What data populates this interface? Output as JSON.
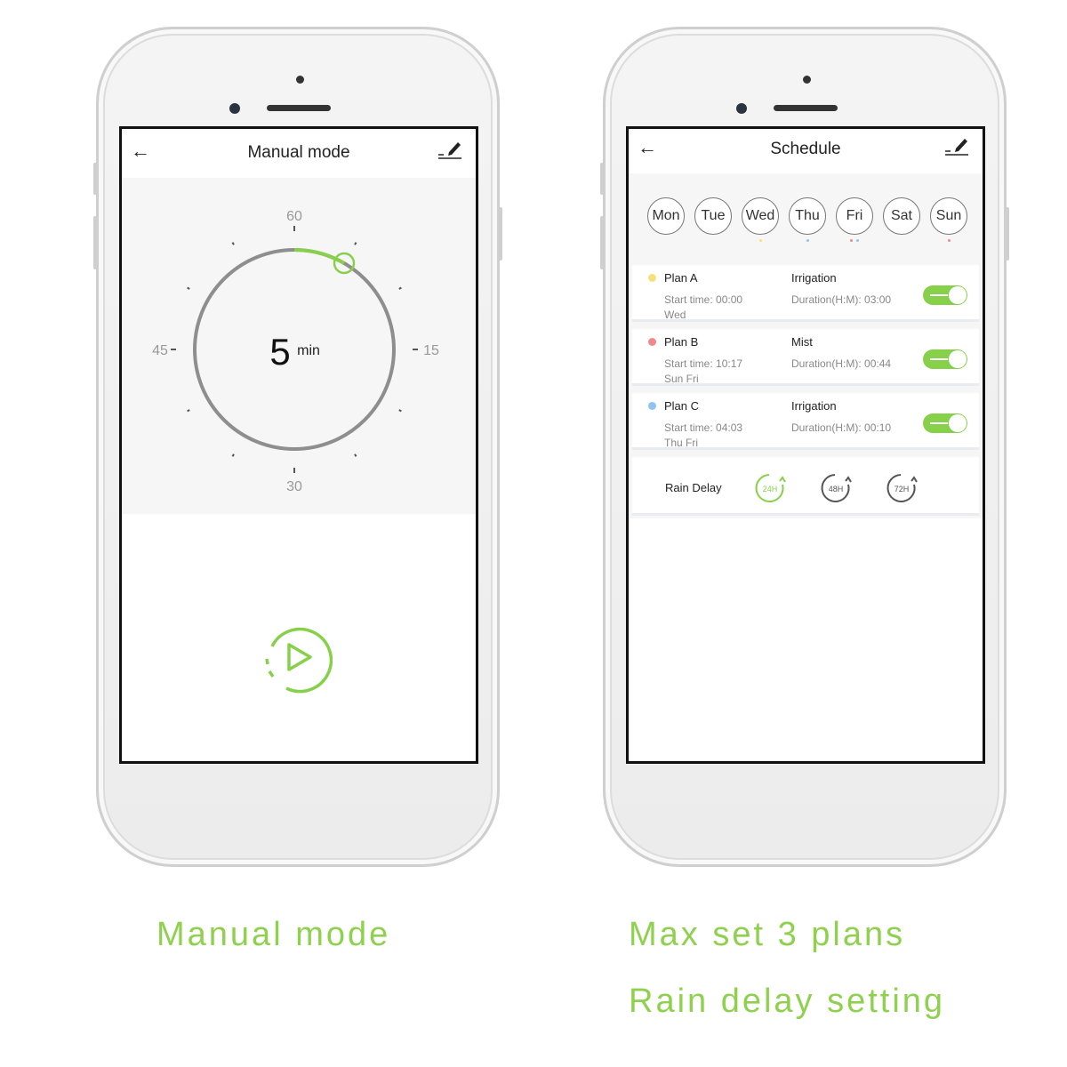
{
  "manual": {
    "title": "Manual mode",
    "dial_labels": {
      "top": "60",
      "right": "15",
      "bottom": "30",
      "left": "45"
    },
    "value": "5",
    "unit": "min",
    "value_minutes": 5,
    "dial_max": 60,
    "caption": "Manual mode",
    "icons": {
      "back": "arrow-left-icon",
      "edit": "pencil-icon",
      "play": "play-icon"
    }
  },
  "schedule": {
    "title": "Schedule",
    "days": [
      {
        "label": "Mon",
        "dots": []
      },
      {
        "label": "Tue",
        "dots": []
      },
      {
        "label": "Wed",
        "dots": [
          "#f5e07a"
        ]
      },
      {
        "label": "Thu",
        "dots": [
          "#8ec3f2"
        ]
      },
      {
        "label": "Fri",
        "dots": [
          "#f08a8a",
          "#8ec3f2"
        ]
      },
      {
        "label": "Sat",
        "dots": []
      },
      {
        "label": "Sun",
        "dots": [
          "#f08a8a"
        ]
      }
    ],
    "plans": [
      {
        "name": "Plan A",
        "color": "#f5e07a",
        "start": "Start time: 00:00",
        "days": "Wed",
        "type": "Irrigation",
        "duration": "Duration(H:M): 03:00",
        "enabled": true
      },
      {
        "name": "Plan B",
        "color": "#f08a8a",
        "start": "Start time: 10:17",
        "days": "Sun Fri",
        "type": "Mist",
        "duration": "Duration(H:M): 00:44",
        "enabled": true
      },
      {
        "name": "Plan C",
        "color": "#8ec3f2",
        "start": "Start time: 04:03",
        "days": "Thu Fri",
        "type": "Irrigation",
        "duration": "Duration(H:M): 00:10",
        "enabled": true
      }
    ],
    "rain_delay": {
      "label": "Rain Delay",
      "options": [
        "24H",
        "48H",
        "72H"
      ],
      "selected": "24H"
    },
    "captions": [
      "Max set 3 plans",
      "Rain delay setting"
    ]
  },
  "colors": {
    "accent": "#86d04a",
    "caption": "#8fd14f",
    "dial_track": "#8e8e8e"
  }
}
